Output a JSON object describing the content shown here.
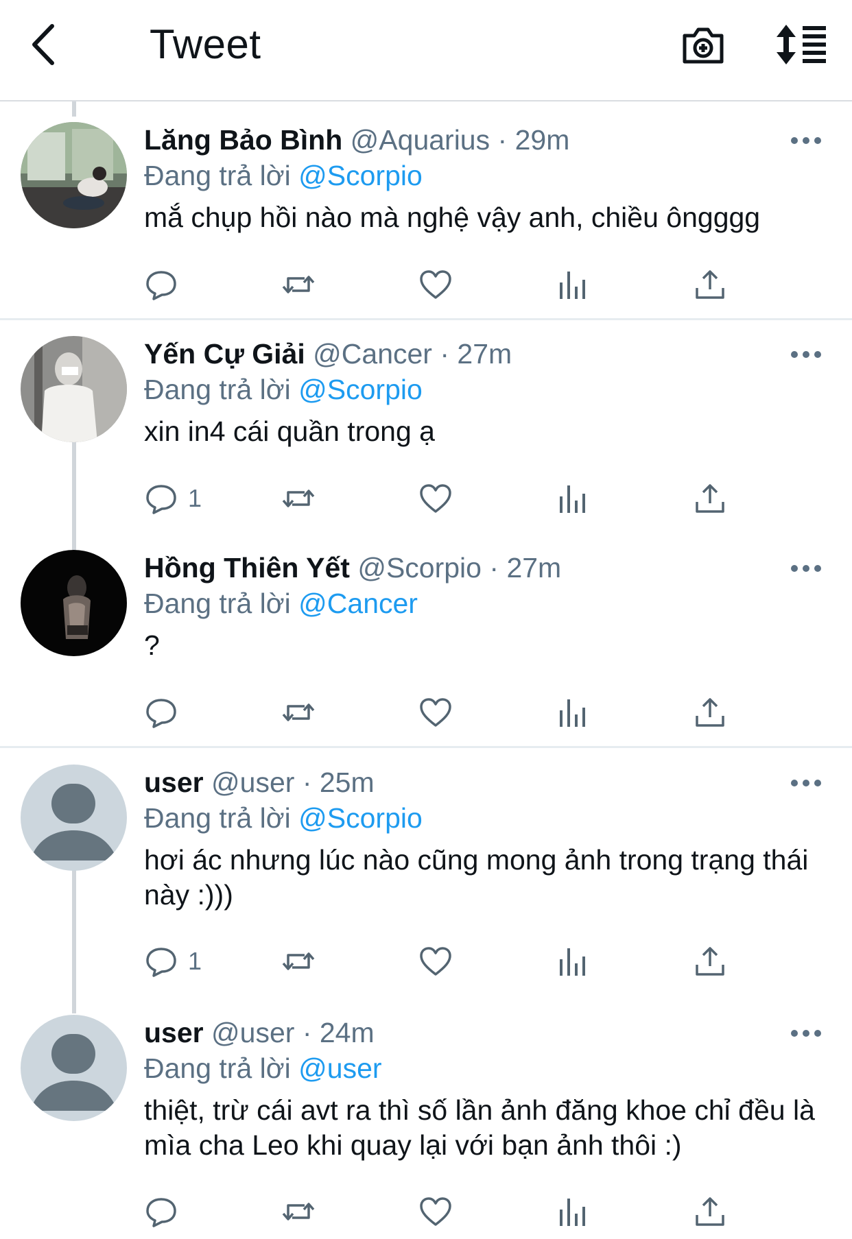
{
  "header": {
    "title": "Tweet"
  },
  "replying_label": "Đang trả lời",
  "tweets": [
    {
      "name": "Lăng Bảo Bình",
      "handle": "@Aquarius",
      "dot": "·",
      "time": "29m",
      "reply_to": "@Scorpio",
      "text": "mắ chụp hồi nào mà nghệ vậy anh, chiều ôngggg",
      "reply_count": ""
    },
    {
      "name": "Yến Cự Giải",
      "handle": "@Cancer",
      "dot": "·",
      "time": "27m",
      "reply_to": "@Scorpio",
      "text": "xin in4 cái quần trong ạ",
      "reply_count": "1"
    },
    {
      "name": "Hồng Thiên Yết",
      "handle": "@Scorpio",
      "dot": "·",
      "time": "27m",
      "reply_to": "@Cancer",
      "text": "?",
      "reply_count": ""
    },
    {
      "name": "user",
      "handle": "@user",
      "dot": "·",
      "time": "25m",
      "reply_to": "@Scorpio",
      "text": "hơi ác nhưng lúc nào cũng mong ảnh trong trạng thái này :)))",
      "reply_count": "1"
    },
    {
      "name": "user",
      "handle": "@user",
      "dot": "·",
      "time": "24m",
      "reply_to": "@user",
      "text": "thiệt, trừ cái avt ra thì số lần ảnh đăng khoe chỉ đều là mìa cha Leo khi quay lại với bạn ảnh thôi :)",
      "reply_count": ""
    }
  ],
  "icons": {
    "back": "chevron-left-icon",
    "camera": "camera-plus-icon",
    "sort": "sort-icon",
    "more": "more-icon",
    "reply": "reply-icon",
    "retweet": "retweet-icon",
    "like": "heart-icon",
    "analytics": "analytics-icon",
    "share": "share-icon"
  },
  "colors": {
    "accent": "#1d9bf0",
    "secondary_text": "#5b7083",
    "icon": "#536471"
  }
}
